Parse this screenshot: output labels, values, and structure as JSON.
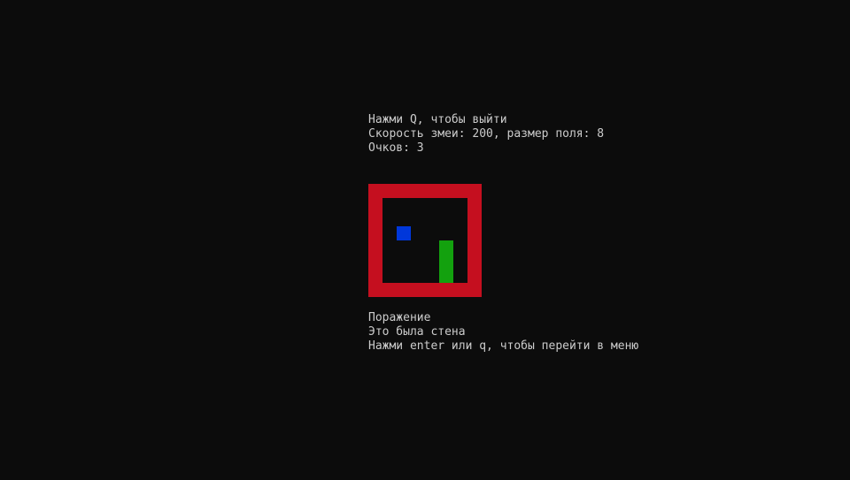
{
  "colors": {
    "background": "#0c0c0c",
    "text": "#cccccc",
    "wall": "#c50f1f",
    "snake": "#13a10e",
    "food": "#0037da"
  },
  "header": {
    "quit_hint": "Нажми Q, чтобы выйти",
    "settings": "Скорость змеи: 200, размер поля: 8",
    "score": "Очков: 3"
  },
  "game": {
    "field_size": 8,
    "snake": [
      [
        5,
        4
      ],
      [
        5,
        5
      ],
      [
        5,
        6
      ]
    ],
    "food": [
      2,
      3
    ]
  },
  "footer": {
    "result": "Поражение",
    "reason": "Это была стена",
    "menu_hint": "Нажми enter или q, чтобы перейти в меню"
  }
}
